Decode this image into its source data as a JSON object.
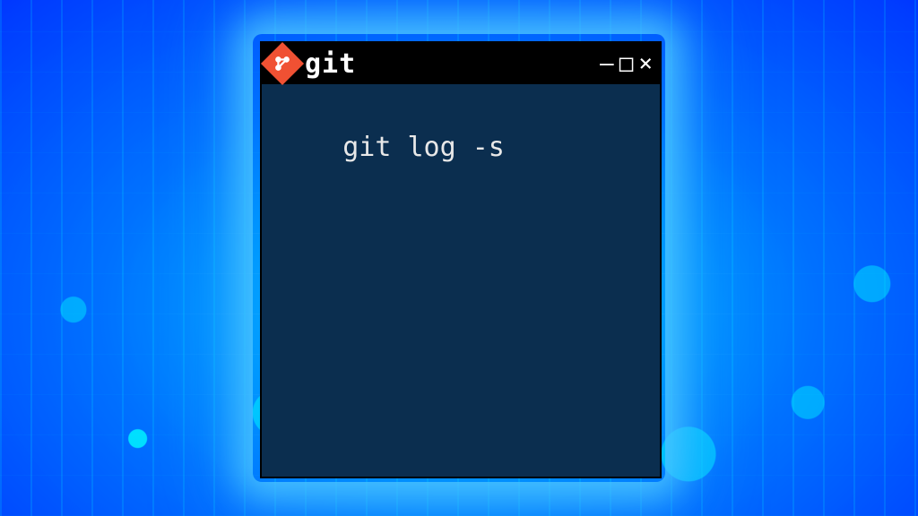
{
  "window": {
    "title": "git",
    "controls": {
      "minimize": "–",
      "maximize": "□",
      "close": "×"
    }
  },
  "terminal": {
    "command": "git log -s"
  },
  "colors": {
    "git_orange": "#f05133",
    "terminal_bg": "#0b2e4f",
    "titlebar_bg": "#000000"
  }
}
